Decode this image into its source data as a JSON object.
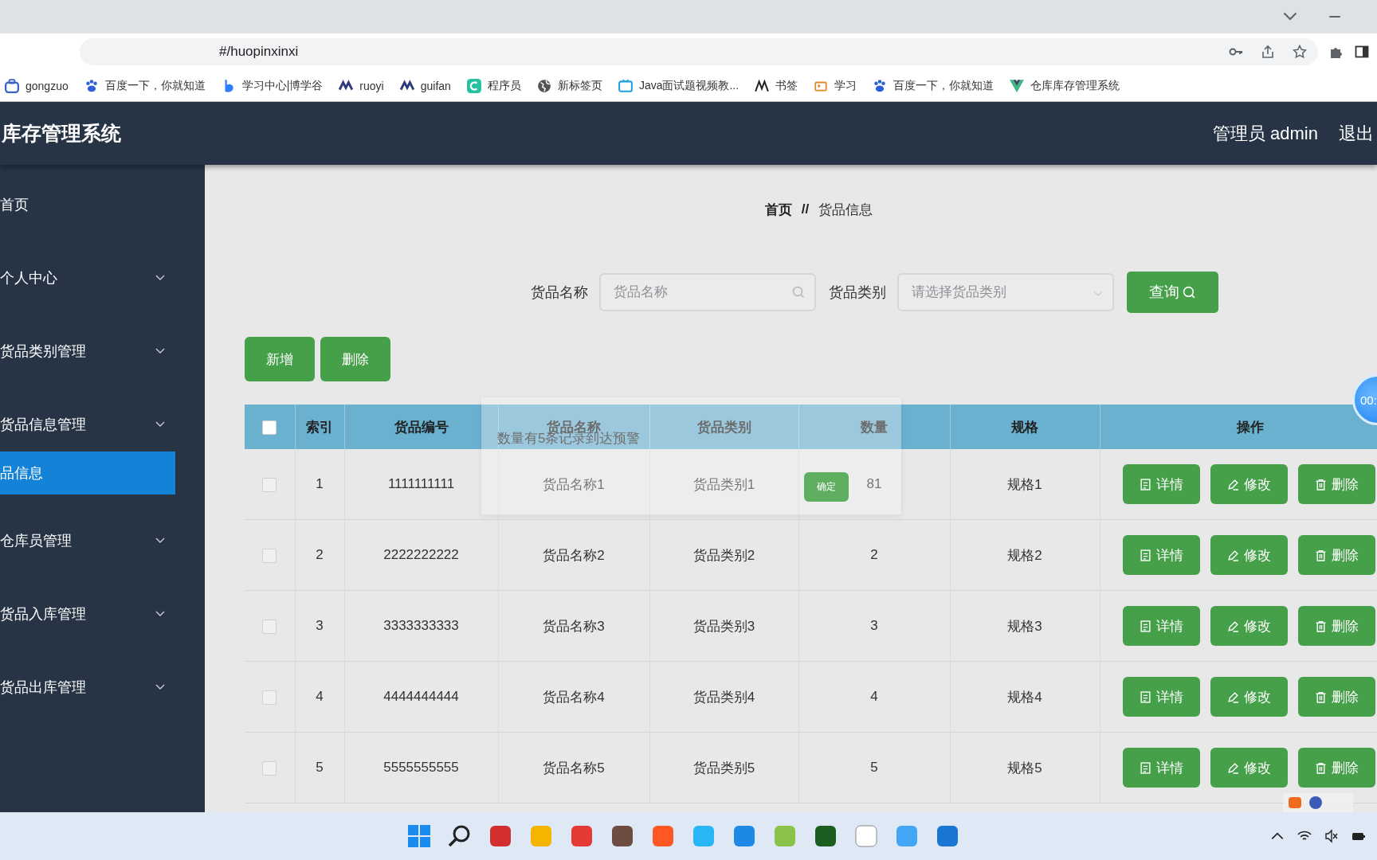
{
  "browser": {
    "url": "#/huopinxinxi",
    "bookmarks": [
      {
        "label": "gongzuo"
      },
      {
        "label": "百度一下，你就知道"
      },
      {
        "label": "学习中心|博学谷"
      },
      {
        "label": "ruoyi"
      },
      {
        "label": "guifan"
      },
      {
        "label": "程序员"
      },
      {
        "label": "新标签页"
      },
      {
        "label": "Java面试题视频教..."
      },
      {
        "label": "书签"
      },
      {
        "label": "学习"
      },
      {
        "label": "百度一下，你就知道"
      },
      {
        "label": "仓库库存管理系统"
      }
    ]
  },
  "header": {
    "title": "库存管理系统",
    "user": "管理员 admin",
    "logout": "退出"
  },
  "sidebar": {
    "items": [
      {
        "label": "首页",
        "selected": false,
        "kind": "link"
      },
      {
        "label": "个人中心",
        "selected": false,
        "kind": "group"
      },
      {
        "label": "货品类别管理",
        "selected": false,
        "kind": "group"
      },
      {
        "label": "货品信息管理",
        "selected": false,
        "kind": "group",
        "children": [
          {
            "label": "品信息",
            "selected": true
          }
        ]
      },
      {
        "label": "仓库员管理",
        "selected": false,
        "kind": "group"
      },
      {
        "label": "货品入库管理",
        "selected": false,
        "kind": "group"
      },
      {
        "label": "货品出库管理",
        "selected": false,
        "kind": "group"
      }
    ]
  },
  "breadcrumb": {
    "home": "首页",
    "separator": "//",
    "current": "货品信息"
  },
  "search": {
    "name_label": "货品名称",
    "name_placeholder": "货品名称",
    "category_label": "货品类别",
    "category_placeholder": "请选择货品类别",
    "button": "查询"
  },
  "actions": [
    "新增",
    "删除"
  ],
  "table": {
    "header_checked": false,
    "columns": [
      "索引",
      "货品编号",
      "货品名称",
      "货品类别",
      "数量",
      "规格",
      "操作"
    ],
    "rows": [
      {
        "checked": false,
        "cells": [
          "1",
          "1111111111",
          "货品名称1",
          "货品类别1",
          "81",
          "规格1"
        ],
        "buttons": [
          "详情",
          "修改",
          "删除"
        ]
      },
      {
        "checked": false,
        "cells": [
          "2",
          "2222222222",
          "货品名称2",
          "货品类别2",
          "2",
          "规格2"
        ],
        "buttons": [
          "详情",
          "修改",
          "删除"
        ]
      },
      {
        "checked": false,
        "cells": [
          "3",
          "3333333333",
          "货品名称3",
          "货品类别3",
          "3",
          "规格3"
        ],
        "buttons": [
          "详情",
          "修改",
          "删除"
        ]
      },
      {
        "checked": false,
        "cells": [
          "4",
          "4444444444",
          "货品名称4",
          "货品类别4",
          "4",
          "规格4"
        ],
        "buttons": [
          "详情",
          "修改",
          "删除"
        ]
      },
      {
        "checked": false,
        "cells": [
          "5",
          "5555555555",
          "货品名称5",
          "货品类别5",
          "5",
          "规格5"
        ],
        "buttons": [
          "详情",
          "修改",
          "删除"
        ]
      }
    ]
  },
  "popconfirm": {
    "message": "数量有5条记录到达预警",
    "confirm": "确定"
  },
  "timer": "00:"
}
